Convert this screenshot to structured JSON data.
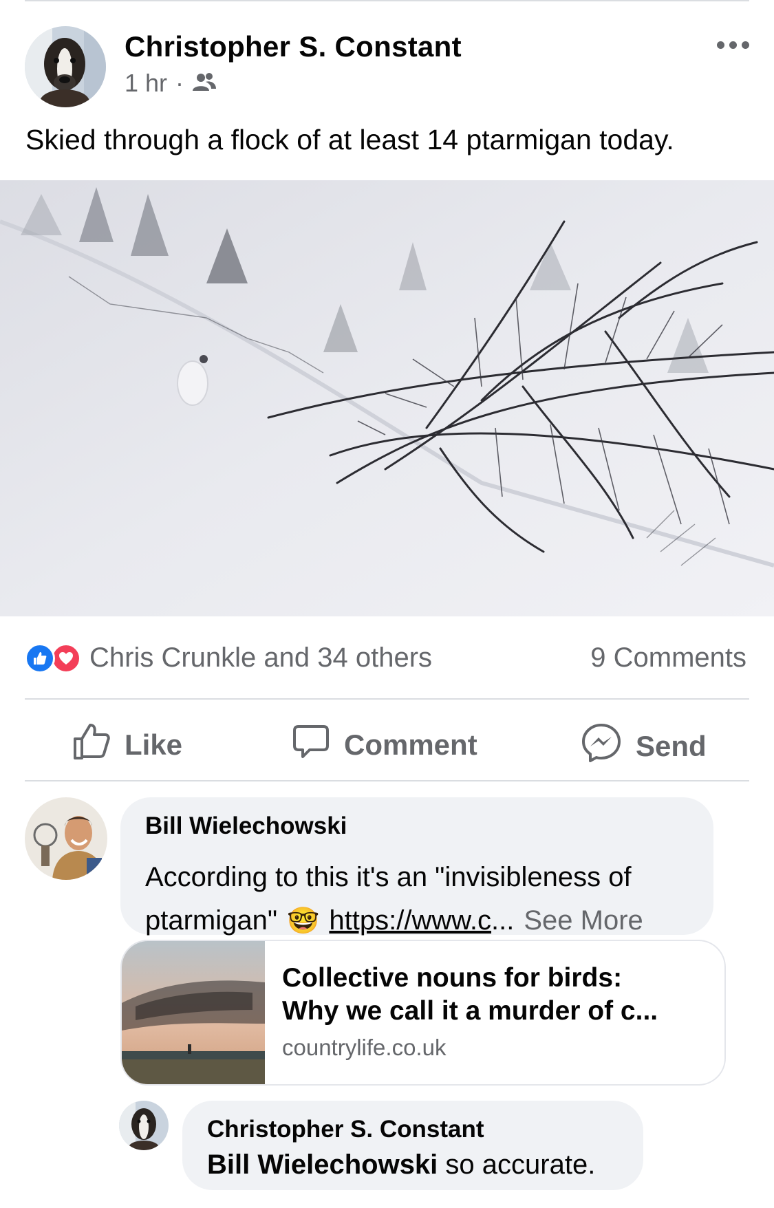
{
  "post": {
    "author": "Christopher S. Constant",
    "time": "1 hr",
    "separator": "·",
    "text": "Skied through a flock of at least 14 ptarmigan today."
  },
  "reactions": {
    "summary": "Chris Crunkle and 34 others",
    "comments_count": "9 Comments",
    "icons": [
      "like-icon",
      "love-icon"
    ]
  },
  "actions": {
    "like": "Like",
    "comment": "Comment",
    "send": "Send"
  },
  "comments": [
    {
      "author": "Bill Wielechowski",
      "text_line1": "According to this it's an \"invisibleness of",
      "text_line2_start": "ptarmigan\"",
      "emoji": "🤓",
      "link_text": "https://www.c",
      "ellipsis": "...",
      "see_more": "See More",
      "link_card": {
        "title_line1": "Collective nouns for birds:",
        "title_line2": "Why we call it a murder of c...",
        "domain": "countrylife.co.uk"
      }
    },
    {
      "author": "Christopher S. Constant",
      "mention": "Bill Wielechowski",
      "text": " so accurate."
    }
  ],
  "colors": {
    "secondary_text": "#65676b",
    "bubble_bg": "#f0f2f5",
    "like_blue": "#1877f2",
    "love_red": "#f33e58",
    "divider": "#dadde1"
  }
}
